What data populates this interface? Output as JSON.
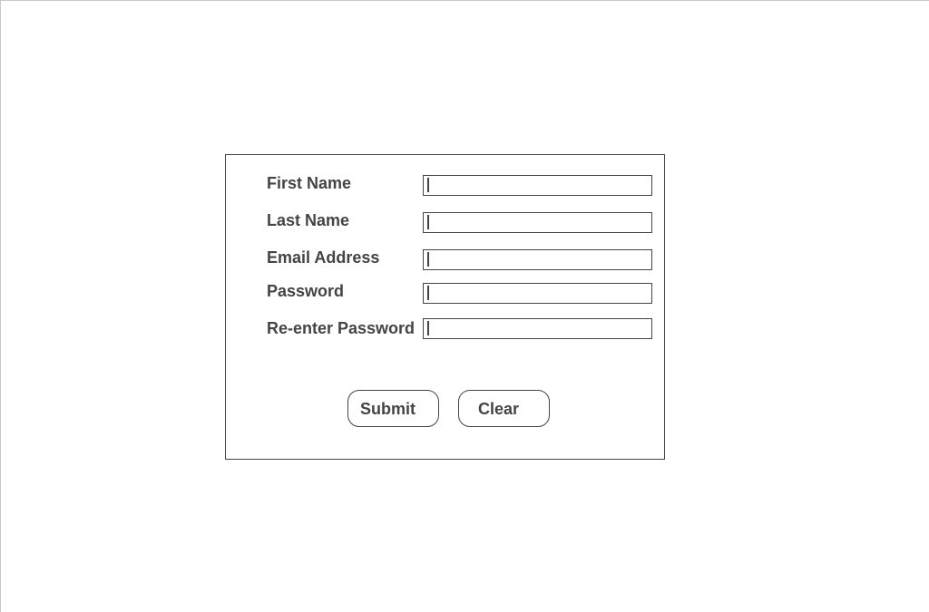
{
  "form": {
    "fields": [
      {
        "label": "First Name",
        "value": ""
      },
      {
        "label": "Last Name",
        "value": ""
      },
      {
        "label": "Email Address",
        "value": ""
      },
      {
        "label": "Password",
        "value": ""
      },
      {
        "label": "Re-enter Password",
        "value": ""
      }
    ],
    "submit_label": "Submit",
    "clear_label": "Clear"
  }
}
